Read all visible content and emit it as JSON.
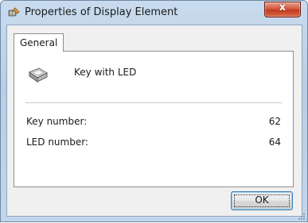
{
  "window": {
    "title": "Properties of Display Element",
    "close_symbol": "x"
  },
  "tabs": [
    {
      "label": "General"
    }
  ],
  "element": {
    "icon": "key-icon",
    "name": "Key with LED"
  },
  "properties": [
    {
      "label": "Key number:",
      "value": "62"
    },
    {
      "label": "LED number:",
      "value": "64"
    }
  ],
  "buttons": {
    "ok_label": "OK"
  },
  "colors": {
    "title_gradient_top": "#c9dbee",
    "close_button": "#c23a1f",
    "panel_bg": "#ffffff",
    "client_bg": "#f0f0f0"
  }
}
